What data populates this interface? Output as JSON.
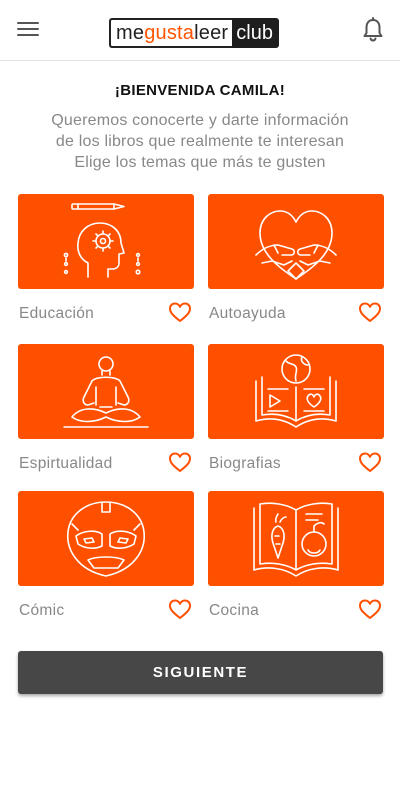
{
  "header": {
    "logo": {
      "part1": "me",
      "part2": "gusta",
      "part3": "leer",
      "part4": "club"
    },
    "menu_icon": "hamburger-icon",
    "notification_icon": "bell-icon"
  },
  "welcome": {
    "title": "¡BIENVENIDA CAMILA!",
    "intro_line1": "Queremos conocerte y darte información",
    "intro_line2": "de los libros que realmente te interesan",
    "intro_line3": "Elige los temas que más te gusten"
  },
  "categories": [
    {
      "label": "Educación",
      "icon": "head-gear-icon"
    },
    {
      "label": "Autoayuda",
      "icon": "heart-hands-icon"
    },
    {
      "label": "Espirtualidad",
      "icon": "meditation-icon"
    },
    {
      "label": "Biografias",
      "icon": "open-book-globe-icon"
    },
    {
      "label": "Cómic",
      "icon": "superhero-mask-icon"
    },
    {
      "label": "Cocina",
      "icon": "recipe-book-icon"
    }
  ],
  "actions": {
    "next_label": "SIGUIENTE"
  },
  "colors": {
    "accent": "#ff5000",
    "button": "#474747",
    "muted_text": "#888888"
  }
}
